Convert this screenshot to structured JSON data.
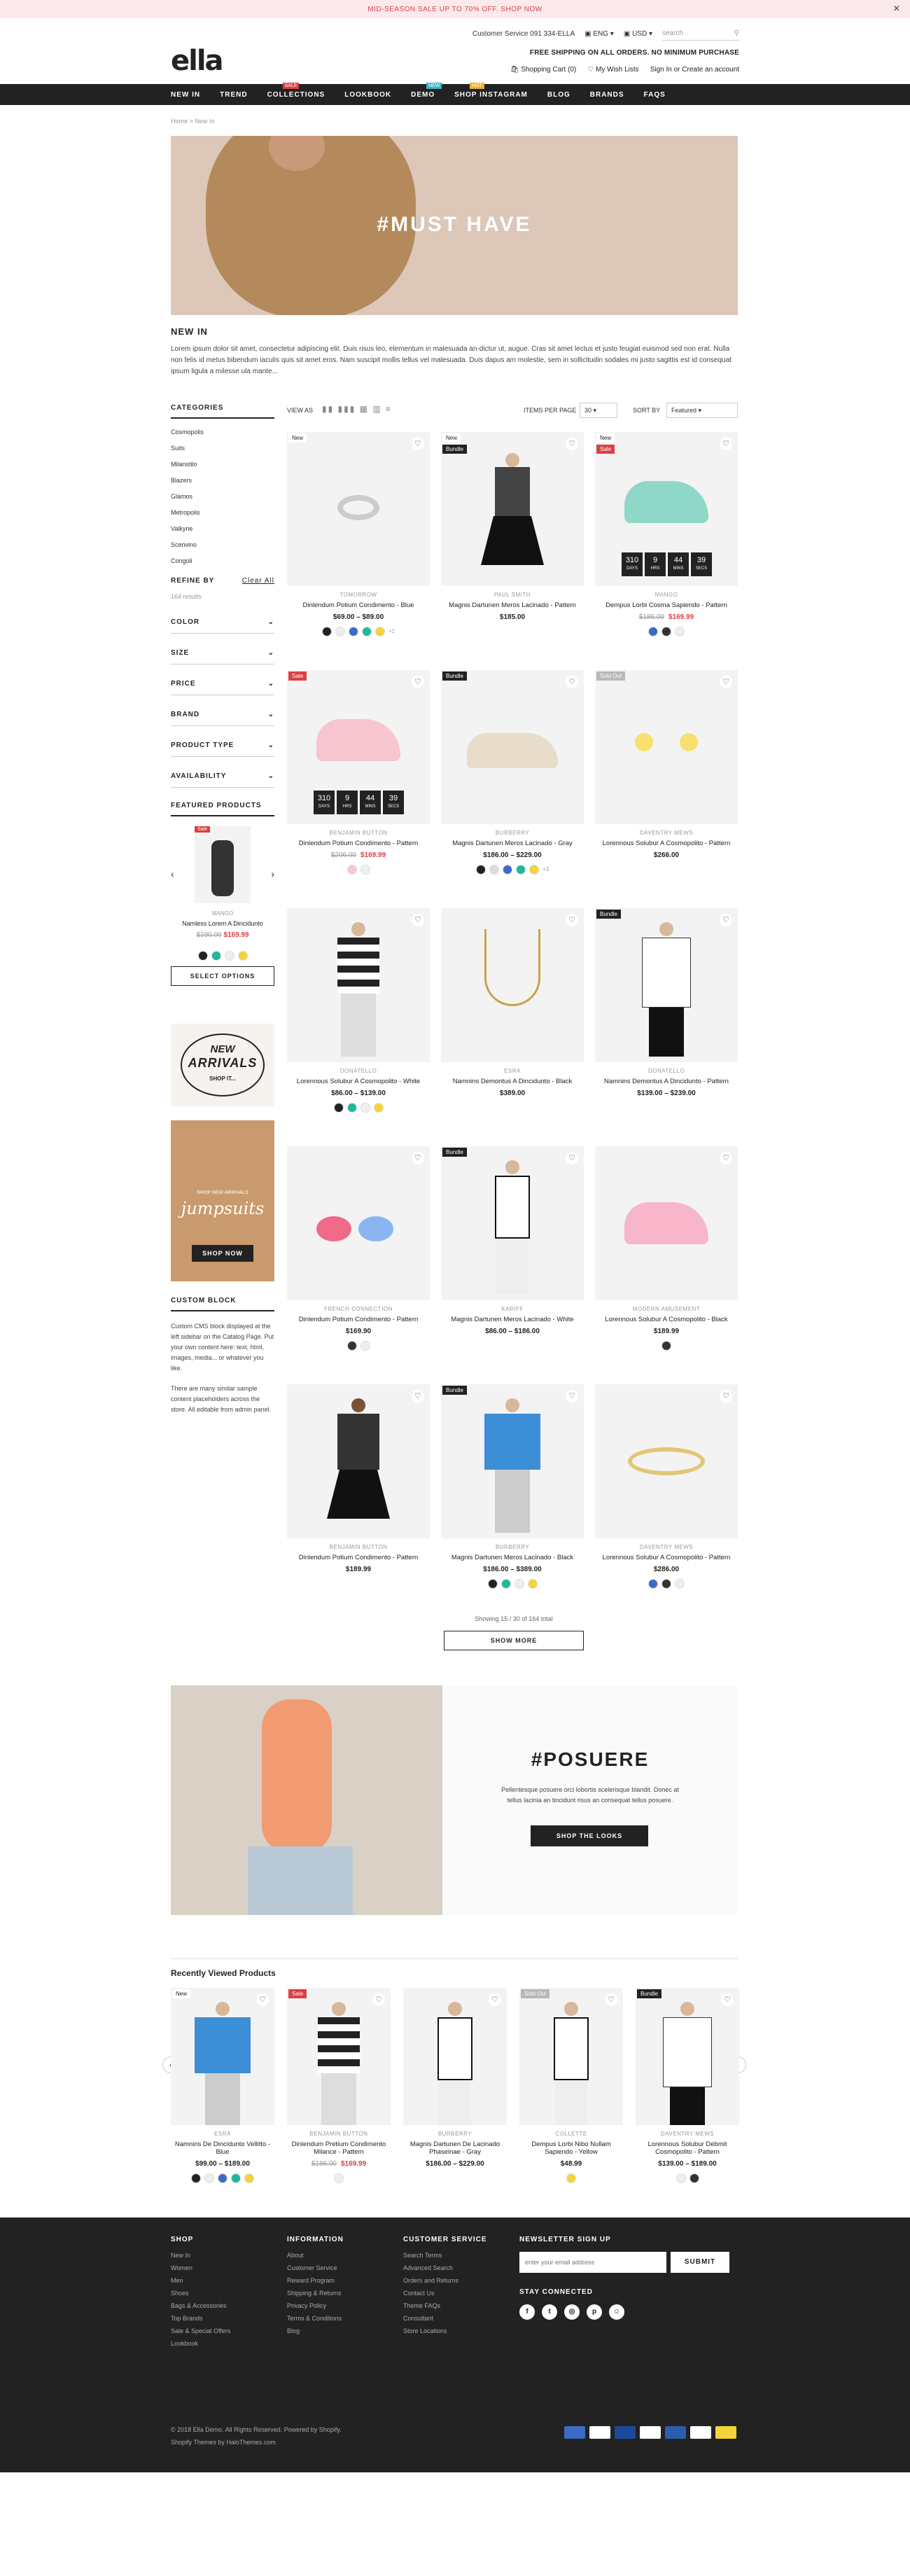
{
  "topbar": {
    "promo": "MID-SEASON SALE UP TO 70% OFF. SHOP NOW",
    "close": "×"
  },
  "header": {
    "logo": "ella",
    "customer_service": "Customer Service 091 334-ELLA",
    "lang": "ENG",
    "currency": "USD",
    "search_placeholder": "search",
    "free_shipping": "FREE SHIPPING ON ALL ORDERS. NO MINIMUM PURCHASE",
    "cart": "Shopping Cart",
    "cart_count": "0",
    "wishlist": "My Wish Lists",
    "signin": "Sign In or Create an account"
  },
  "nav": [
    {
      "label": "NEW IN"
    },
    {
      "label": "TREND"
    },
    {
      "label": "COLLECTIONS",
      "tag": "SALE",
      "tag_color": "#d94046"
    },
    {
      "label": "LOOKBOOK"
    },
    {
      "label": "DEMO",
      "tag": "NEW",
      "tag_color": "#35b6c7"
    },
    {
      "label": "SHOP INSTAGRAM",
      "tag": "HOT",
      "tag_color": "#f0b233"
    },
    {
      "label": "BLOG"
    },
    {
      "label": "BRANDS"
    },
    {
      "label": "FAQS"
    }
  ],
  "breadcrumb": {
    "home": "Home",
    "sep": ">",
    "current": "New In"
  },
  "hero": {
    "title": "#MUST HAVE"
  },
  "intro": {
    "title": "NEW IN",
    "text": "Lorem ipsum dolor sit amet, consectetur adipiscing elit. Duis risus leo, elementum in malesuada an-dictur ut, augue. Cras sit amet lectus et justo feugiat euismod sed non erat. Nulla non felis id metus bibendum iaculis quis sit amet eros. Nam suscipit mollis tellus vel malesuada. Duis dapus am molestie, sem in sollicitudin sodales mi justo sagittis est id consequat ipsum ligula a milesse ula mante..."
  },
  "sidebar": {
    "categories_title": "CATEGORIES",
    "categories": [
      "Cosmopolis",
      "Suits",
      "Milanstilo",
      "Blazers",
      "Glamos",
      "Metropolis",
      "Valkyrie",
      "Scenvino",
      "Congoli"
    ],
    "refine_title": "REFINE BY",
    "clear_all": "Clear All",
    "results": "164 results",
    "filters": [
      "COLOR",
      "SIZE",
      "PRICE",
      "BRAND",
      "PRODUCT TYPE",
      "AVAILABILITY"
    ],
    "featured_title": "FEATURED PRODUCTS",
    "featured": {
      "vendor": "MANGO",
      "name": "Namless Lorem A Dincidunto",
      "old_price": "$190.00",
      "price": "$169.99",
      "badge": "Sale",
      "button": "SELECT OPTIONS"
    },
    "banner1_line1": "NEW",
    "banner1_line2": "ARRIVALS",
    "banner1_cta": "SHOP IT...",
    "banner2_small": "SHOP NEW ARRIVALS",
    "banner2_big": "jumpsuits",
    "banner2_cta": "SHOP NOW",
    "custom_title": "CUSTOM BLOCK",
    "custom_text1": "Custom CMS block displayed at the left sidebar on the Catalog Page. Put your own content here: text, html, images, media... or whatever you like.",
    "custom_text2": "There are many similar sample content placeholders across the store. All editable from admin panel."
  },
  "toolbar": {
    "view_as": "VIEW AS",
    "items_per_page": "ITEMS PER PAGE",
    "per_page_value": "30",
    "sort_by": "SORT BY",
    "sort_value": "Featured"
  },
  "products": [
    {
      "badge": "New",
      "vendor": "TOMORROW",
      "name": "Dinlendum Potium Condimento - Blue",
      "price": "$69.00 – $89.00",
      "more": "+1"
    },
    {
      "badge": "New",
      "badge2": "Bundle",
      "vendor": "PAUL SMITH",
      "name": "Magnis Dartunen Meros Lacinado - Pattern",
      "price": "$185.00"
    },
    {
      "badge": "New",
      "badge2": "Sale",
      "vendor": "MANGO",
      "name": "Dempus Lorbi Cosma Sapiendo - Pattern",
      "old_price": "$186.00",
      "price": "$169.99",
      "timer": [
        "310",
        "9",
        "44",
        "39"
      ]
    },
    {
      "badge": "Sale",
      "vendor": "BENJAMIN BUTTON",
      "name": "Dinlendum Potium Condimento - Pattern",
      "old_price": "$206.00",
      "price": "$169.99",
      "timer": [
        "310",
        "9",
        "44",
        "39"
      ]
    },
    {
      "badge": "Bundle",
      "vendor": "BURBERRY",
      "name": "Magnis Dartunen Meros Lacinado - Gray",
      "price": "$186.00 – $229.00",
      "more": "+3"
    },
    {
      "badge": "Sold Out",
      "vendor": "DAVENTRY MEWS",
      "name": "Lorennous Solubur A Cosmopolito - Pattern",
      "price": "$266.00"
    },
    {
      "vendor": "DONATELLO",
      "name": "Lorennous Solubur A Cosmopolito - White",
      "price": "$86.00 – $139.00"
    },
    {
      "vendor": "ESRA",
      "name": "Namnins Demontus A Dincidunto - Black",
      "price": "$389.00"
    },
    {
      "badge": "Bundle",
      "vendor": "DONATELLO",
      "name": "Namnins Demontus A Dincidunto - Pattern",
      "price": "$139.00 – $239.00"
    },
    {
      "vendor": "FRENCH CONNECTION",
      "name": "Dinlendum Potium Condimento - Pattern",
      "price": "$169.90"
    },
    {
      "badge": "Bundle",
      "vendor": "KARIFF",
      "name": "Magnis Dartunen Meros Lacinado - White",
      "price": "$86.00 – $186.00"
    },
    {
      "vendor": "MODERN AMUSEMENT",
      "name": "Lorennous Solubur A Cosmopolito - Black",
      "price": "$189.99"
    },
    {
      "vendor": "BENJAMIN BUTTON",
      "name": "Dinlendum Potium Condimento - Pattern",
      "price": "$189.99"
    },
    {
      "badge": "Bundle",
      "vendor": "BURBERRY",
      "name": "Magnis Dartunen Meros Lacinado - Black",
      "price": "$186.00 – $389.00"
    },
    {
      "vendor": "DAVENTRY MEWS",
      "name": "Lorennous Solubur A Cosmopolito - Pattern",
      "price": "$286.00"
    }
  ],
  "timer_units": [
    "DAYS",
    "HRS",
    "MINS",
    "SECS"
  ],
  "pagination": {
    "showing": "Showing 15 / 30 of 164 total",
    "button": "SHOW MORE"
  },
  "posuere": {
    "title": "#POSUERE",
    "text": "Pellentesque posuere orci lobortis scelerisque blandit. Donec at tellus lacinia an tincidunt risus an consequat tellus posuere.",
    "button": "SHOP THE LOOKS"
  },
  "recent": {
    "title": "Recently Viewed Products",
    "items": [
      {
        "badge": "New",
        "vendor": "ESRA",
        "name": "Namnins De Dincidunto Vellitto - Blue",
        "price": "$99.00 – $189.00"
      },
      {
        "badge": "Sale",
        "vendor": "BENJAMIN BUTTON",
        "name": "Dinlendum Pretium Condimento Milance - Pattern",
        "old_price": "$186.00",
        "price": "$169.99"
      },
      {
        "vendor": "BURBERRY",
        "name": "Magnis Dartunen De Lacinado Phaseinae - Gray",
        "price": "$186.00 – $229.00"
      },
      {
        "badge": "Sold Out",
        "vendor": "COLLETTE",
        "name": "Dempus Lorbi Nibo Nullam Sapiendo - Yellow",
        "price": "$48.99"
      },
      {
        "badge": "Bundle",
        "vendor": "DAVENTRY MEWS",
        "name": "Lorennous Solubur Debmit Cosmopolito - Pattern",
        "price": "$139.00 – $189.00"
      }
    ]
  },
  "footer": {
    "shop_title": "SHOP",
    "shop": [
      "New In",
      "Women",
      "Men",
      "Shoes",
      "Bags & Accessories",
      "Top Brands",
      "Sale & Special Offers",
      "Lookbook"
    ],
    "info_title": "INFORMATION",
    "info": [
      "About",
      "Customer Service",
      "Reward Program",
      "Shipping & Returns",
      "Privacy Policy",
      "Terms & Conditions",
      "Blog"
    ],
    "cs_title": "CUSTOMER SERVICE",
    "cs": [
      "Search Terms",
      "Advanced Search",
      "Orders and Returns",
      "Contact Us",
      "Theme FAQs",
      "Consultant",
      "Store Locations"
    ],
    "news_title": "NEWSLETTER SIGN UP",
    "news_placeholder": "enter your email address",
    "news_button": "SUBMIT",
    "stay": "STAY CONNECTED",
    "copyright": "© 2018 Ella Demo. All Rights Reserved. Powered by Shopify.",
    "credits": "Shopify Themes by HaloThemes.com"
  },
  "colors": {
    "sale": "#d94046",
    "new": "#ffffff",
    "bundle": "#222222",
    "soldout": "#b8b8b8"
  }
}
